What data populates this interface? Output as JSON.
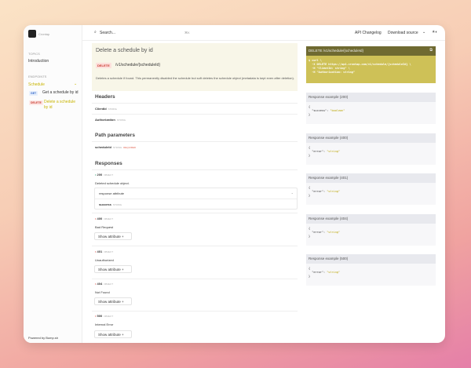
{
  "sidebar": {
    "logo_text": "Crontap",
    "topics_label": "TOPICS",
    "introduction": "Introduction",
    "endpoints_label": "ENDPOINTS",
    "group": "Schedule",
    "items": [
      {
        "method": "GET",
        "label": "Get a schedule by id"
      },
      {
        "method": "DELETE",
        "label": "Delete a schedule by id"
      }
    ],
    "footer": "Powered by Bump.sh"
  },
  "topbar": {
    "search_placeholder": "Search...",
    "shortcut": "⌘K",
    "changelog": "API Changelog",
    "download": "Download source"
  },
  "endpoint": {
    "title": "Delete a schedule by id",
    "method": "DELETE",
    "path": "/v1/schedule/{scheduleId}",
    "description": "Deletes a schedule if found. This permanently disabled the schedule but soft deletes the schedule object (metadata is kept even after deletion)."
  },
  "headers": {
    "title": "Headers",
    "items": [
      {
        "name": "ClientId",
        "type": "STRING"
      },
      {
        "name": "Authorization",
        "type": "STRING"
      }
    ]
  },
  "path_params": {
    "title": "Path parameters",
    "items": [
      {
        "name": "scheduleId",
        "type": "STRING",
        "required": "REQUIRED"
      }
    ]
  },
  "responses": {
    "title": "Responses",
    "items": [
      {
        "code": "200",
        "type": "OBJECT",
        "desc": "Deleted schedule object.",
        "attr_label": "response attribute",
        "attr_name": "success",
        "attr_type": "STRING",
        "color": "#2a9d6f"
      },
      {
        "code": "400",
        "type": "OBJECT",
        "desc": "Bad Request",
        "button": "Show attribute",
        "color": "#d9463c"
      },
      {
        "code": "401",
        "type": "OBJECT",
        "desc": "Unauthorized",
        "button": "Show attribute",
        "color": "#d9463c"
      },
      {
        "code": "404",
        "type": "OBJECT",
        "desc": "Not Found",
        "button": "Show attribute",
        "color": "#d9463c"
      },
      {
        "code": "500",
        "type": "OBJECT",
        "desc": "Internal Error",
        "button": "Show attribute",
        "color": "#d9463c"
      }
    ]
  },
  "code": {
    "header": "DELETE /v1/schedule/{scheduleId}",
    "lines": [
      "$ curl \\",
      "  -X DELETE https://api.crontap.com/v1/schedule/{scheduleId} \\",
      "  -H \"ClientId: string\" \\",
      "  -H \"Authorization: string\""
    ]
  },
  "examples": [
    {
      "title": "Response example (200)",
      "key": "\"success\"",
      "val": "\"boolean\""
    },
    {
      "title": "Response example (400)",
      "key": "\"error\"",
      "val": "\"string\""
    },
    {
      "title": "Response example (401)",
      "key": "\"error\"",
      "val": "\"string\""
    },
    {
      "title": "Response example (404)",
      "key": "\"error\"",
      "val": "\"string\""
    },
    {
      "title": "Response example (500)",
      "key": "\"error\"",
      "val": "\"string\""
    }
  ]
}
